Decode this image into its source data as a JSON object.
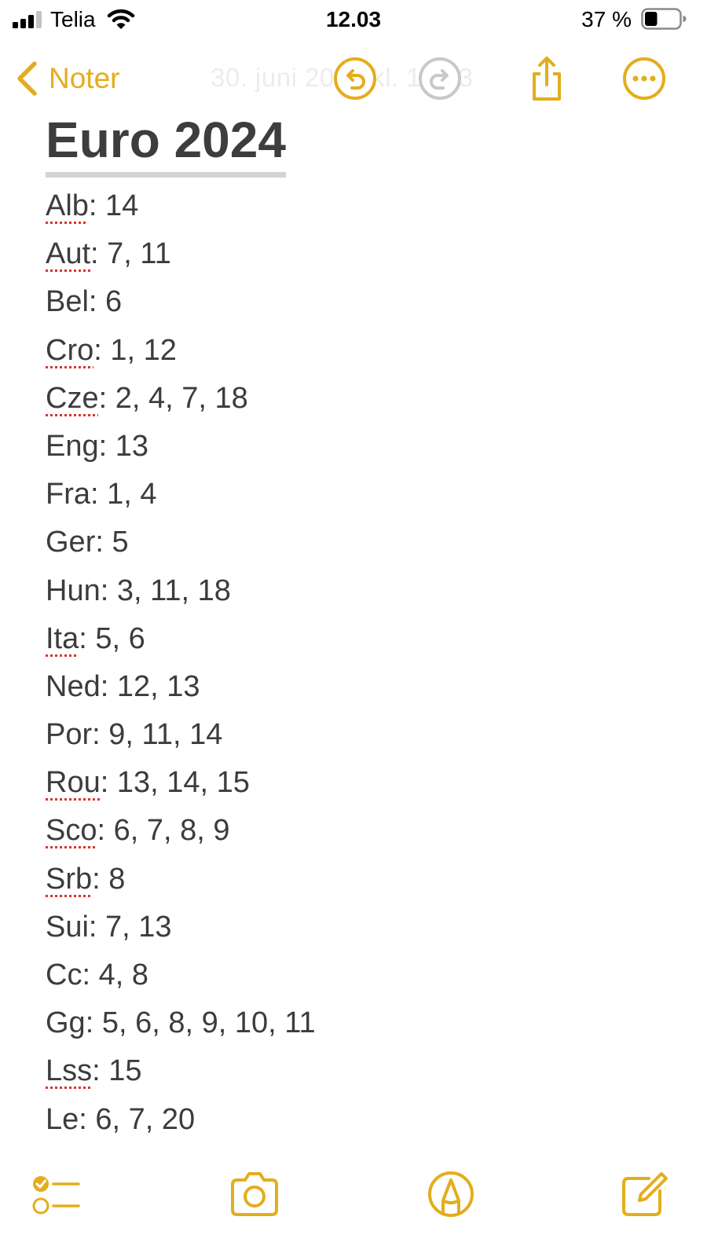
{
  "status_bar": {
    "carrier": "Telia",
    "time": "12.03",
    "battery_percent": "37 %",
    "battery_level": 0.37,
    "icons": [
      "signal-icon",
      "wifi-icon",
      "battery-icon"
    ]
  },
  "nav": {
    "back_label": "Noter",
    "faded_date": "30. juni 2024 kl. 12.03",
    "icons": [
      "chevron-left-icon",
      "undo-icon",
      "redo-icon",
      "share-icon",
      "more-icon"
    ]
  },
  "note": {
    "title": "Euro 2024",
    "lines": [
      {
        "abbr": "Alb",
        "values": ": 14",
        "misspelled": true
      },
      {
        "abbr": "Aut",
        "values": ": 7, 11",
        "misspelled": true
      },
      {
        "abbr": "Bel",
        "values": ": 6",
        "misspelled": false
      },
      {
        "abbr": "Cro",
        "values": ": 1, 12",
        "misspelled": true
      },
      {
        "abbr": "Cze",
        "values": ": 2, 4, 7, 18",
        "misspelled": true
      },
      {
        "abbr": "Eng",
        "values": ": 13",
        "misspelled": false
      },
      {
        "abbr": "Fra",
        "values": ": 1, 4",
        "misspelled": false
      },
      {
        "abbr": "Ger",
        "values": ": 5",
        "misspelled": false
      },
      {
        "abbr": "Hun",
        "values": ": 3, 11, 18",
        "misspelled": false
      },
      {
        "abbr": "Ita",
        "values": ": 5, 6",
        "misspelled": true
      },
      {
        "abbr": "Ned",
        "values": ": 12, 13",
        "misspelled": false
      },
      {
        "abbr": "Por",
        "values": ": 9, 11, 14",
        "misspelled": false
      },
      {
        "abbr": "Rou",
        "values": ": 13, 14, 15",
        "misspelled": true
      },
      {
        "abbr": "Sco",
        "values": ": 6, 7, 8, 9",
        "misspelled": true
      },
      {
        "abbr": "Srb",
        "values": ": 8",
        "misspelled": true
      },
      {
        "abbr": "Sui",
        "values": ": 7, 13",
        "misspelled": false
      },
      {
        "abbr": "Cc",
        "values": ": 4, 8",
        "misspelled": false
      },
      {
        "abbr": "Gg",
        "values": ": 5, 6, 8, 9, 10, 11",
        "misspelled": false
      },
      {
        "abbr": "Lss",
        "values": ": 15",
        "misspelled": true
      },
      {
        "abbr": "Le",
        "values": ": 6, 7, 20",
        "misspelled": false
      }
    ]
  },
  "toolbar": {
    "icons": [
      "checklist-icon",
      "camera-icon",
      "markup-icon",
      "compose-icon"
    ]
  },
  "colors": {
    "accent": "#e3ad1c",
    "text": "#3c3c3c",
    "disabled": "#c8c8c8",
    "spellcheck": "#d9342b"
  }
}
